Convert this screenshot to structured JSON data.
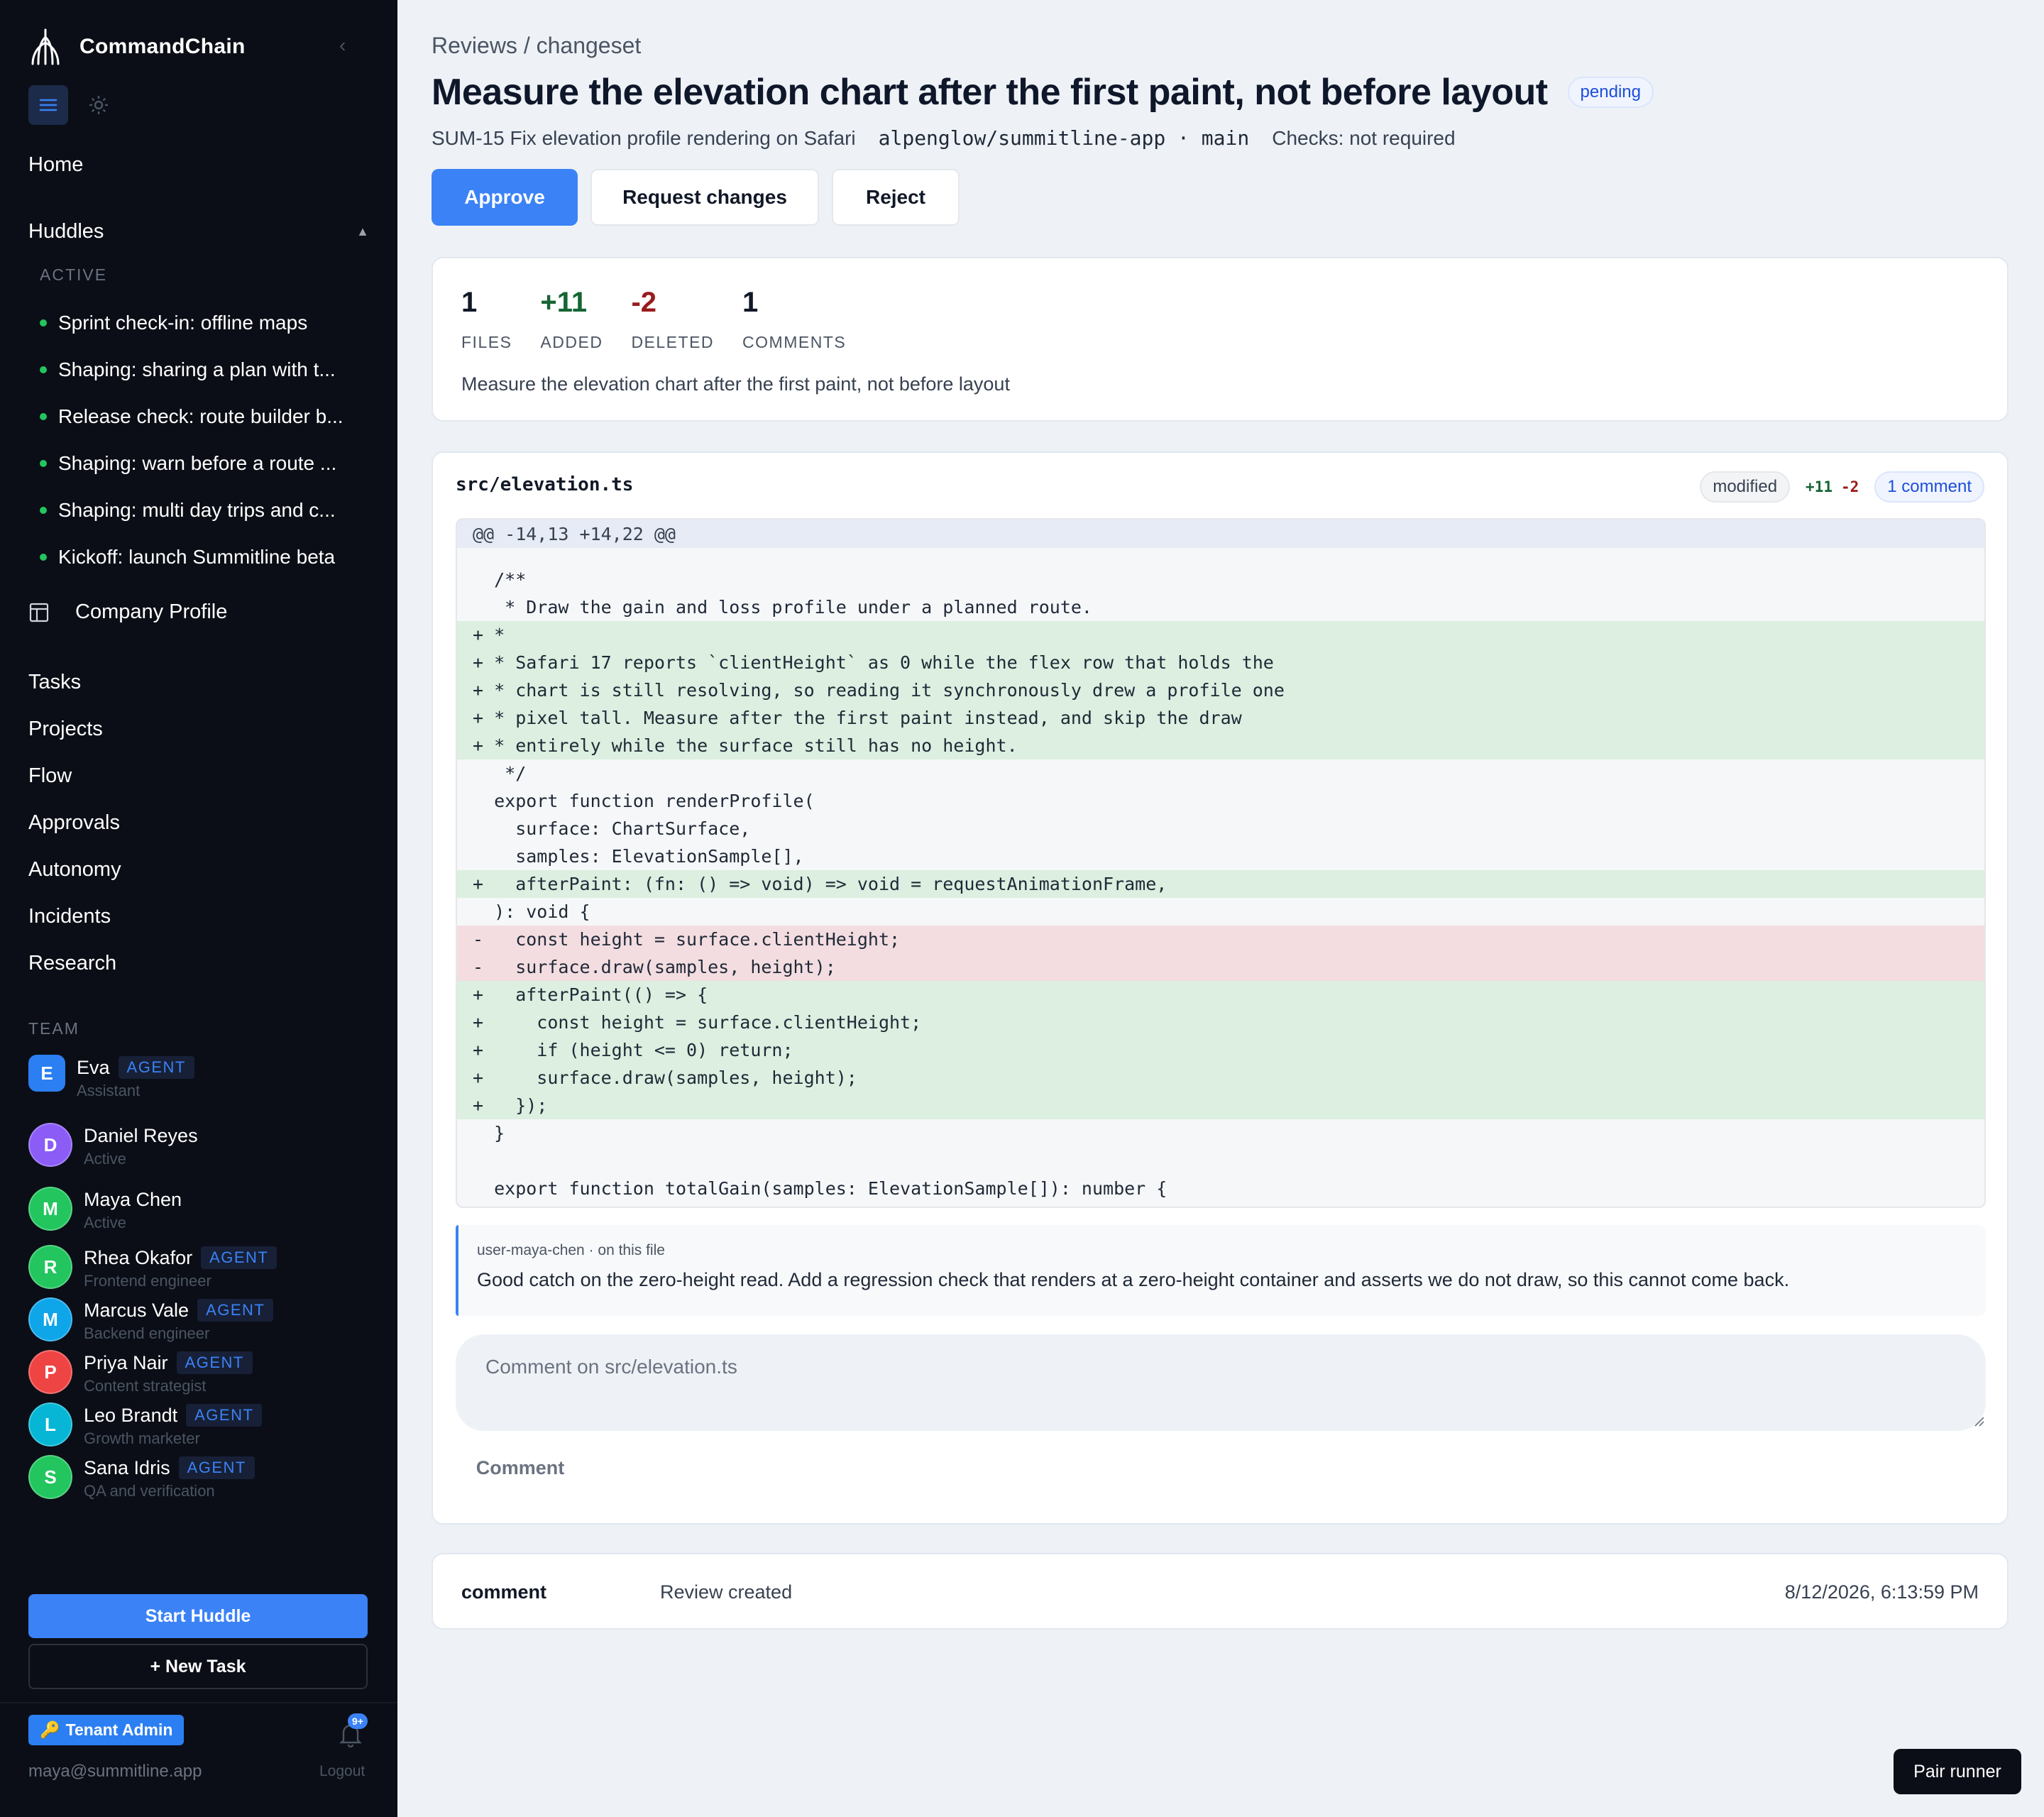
{
  "sidebar": {
    "brand": "CommandChain",
    "home": "Home",
    "huddles_label": "Huddles",
    "active_label": "ACTIVE",
    "huddles": [
      {
        "label": "Sprint check-in: offline maps"
      },
      {
        "label": "Shaping: sharing a plan with t..."
      },
      {
        "label": "Release check: route builder b..."
      },
      {
        "label": "Shaping: warn before a route ..."
      },
      {
        "label": "Shaping: multi day trips and c..."
      },
      {
        "label": "Kickoff: launch Summitline beta"
      }
    ],
    "company_profile": "Company Profile",
    "nav": [
      {
        "label": "Tasks"
      },
      {
        "label": "Projects"
      },
      {
        "label": "Flow"
      },
      {
        "label": "Approvals"
      },
      {
        "label": "Autonomy"
      },
      {
        "label": "Incidents"
      },
      {
        "label": "Research"
      }
    ],
    "team_label": "TEAM",
    "team": [
      {
        "initial": "E",
        "name": "Eva",
        "tag": "AGENT",
        "role": "Assistant",
        "color": "#2b7ff2"
      },
      {
        "initial": "D",
        "name": "Daniel Reyes",
        "tag": "",
        "role": "Active",
        "color": "#8b5cf6"
      },
      {
        "initial": "M",
        "name": "Maya Chen",
        "tag": "",
        "role": "Active",
        "color": "#22c55e"
      },
      {
        "initial": "R",
        "name": "Rhea Okafor",
        "tag": "AGENT",
        "role": "Frontend engineer",
        "color": "#22c55e"
      },
      {
        "initial": "M",
        "name": "Marcus Vale",
        "tag": "AGENT",
        "role": "Backend engineer",
        "color": "#0ea5e9"
      },
      {
        "initial": "P",
        "name": "Priya Nair",
        "tag": "AGENT",
        "role": "Content strategist",
        "color": "#ef4444"
      },
      {
        "initial": "L",
        "name": "Leo Brandt",
        "tag": "AGENT",
        "role": "Growth marketer",
        "color": "#06b6d4"
      },
      {
        "initial": "S",
        "name": "Sana Idris",
        "tag": "AGENT",
        "role": "QA and verification",
        "color": "#22c55e"
      }
    ],
    "start_huddle": "Start Huddle",
    "new_task": "+ New Task",
    "tenant_admin": "Tenant Admin",
    "notification_badge": "9+",
    "user_email": "maya@summitline.app",
    "logout": "Logout"
  },
  "review": {
    "breadcrumb": "Reviews / changeset",
    "title": "Measure the elevation chart after the first paint, not before layout",
    "status": "pending",
    "ticket": "SUM-15 Fix elevation profile rendering on Safari",
    "repo": "alpenglow/summitline-app · main",
    "checks": "Checks: not required",
    "approve": "Approve",
    "request_changes": "Request changes",
    "reject": "Reject"
  },
  "stats": {
    "files": "1",
    "files_label": "FILES",
    "added": "+11",
    "added_label": "ADDED",
    "deleted": "-2",
    "deleted_label": "DELETED",
    "comments": "1",
    "comments_label": "COMMENTS",
    "summary": "Measure the elevation chart after the first paint, not before layout"
  },
  "file": {
    "path": "src/elevation.ts",
    "status": "modified",
    "added": "+11",
    "deleted": "-2",
    "comment_count": "1 comment",
    "hunk_header": "@@ -14,13 +14,22 @@",
    "lines": [
      {
        "type": "blank",
        "text": ""
      },
      {
        "type": "ctx",
        "text": "  /**"
      },
      {
        "type": "ctx",
        "text": "   * Draw the gain and loss profile under a planned route."
      },
      {
        "type": "add",
        "text": "+ *"
      },
      {
        "type": "add",
        "text": "+ * Safari 17 reports `clientHeight` as 0 while the flex row that holds the"
      },
      {
        "type": "add",
        "text": "+ * chart is still resolving, so reading it synchronously drew a profile one"
      },
      {
        "type": "add",
        "text": "+ * pixel tall. Measure after the first paint instead, and skip the draw"
      },
      {
        "type": "add",
        "text": "+ * entirely while the surface still has no height."
      },
      {
        "type": "ctx",
        "text": "   */"
      },
      {
        "type": "ctx",
        "text": "  export function renderProfile("
      },
      {
        "type": "ctx",
        "text": "    surface: ChartSurface,"
      },
      {
        "type": "ctx",
        "text": "    samples: ElevationSample[],"
      },
      {
        "type": "add",
        "text": "+   afterPaint: (fn: () => void) => void = requestAnimationFrame,"
      },
      {
        "type": "ctx",
        "text": "  ): void {"
      },
      {
        "type": "del",
        "text": "-   const height = surface.clientHeight;"
      },
      {
        "type": "del",
        "text": "-   surface.draw(samples, height);"
      },
      {
        "type": "add",
        "text": "+   afterPaint(() => {"
      },
      {
        "type": "add",
        "text": "+     const height = surface.clientHeight;"
      },
      {
        "type": "add",
        "text": "+     if (height <= 0) return;"
      },
      {
        "type": "add",
        "text": "+     surface.draw(samples, height);"
      },
      {
        "type": "add",
        "text": "+   });"
      },
      {
        "type": "ctx",
        "text": "  }"
      },
      {
        "type": "ctx",
        "text": ""
      },
      {
        "type": "ctx",
        "text": "  export function totalGain(samples: ElevationSample[]): number {"
      }
    ],
    "comment": {
      "author": "user-maya-chen · on this file",
      "body": "Good catch on the zero-height read. Add a regression check that renders at a zero-height container and asserts we do not draw, so this cannot come back."
    },
    "comment_placeholder": "Comment on src/elevation.ts",
    "comment_button": "Comment"
  },
  "event": {
    "kind": "comment",
    "text": "Review created",
    "time": "8/12/2026, 6:13:59 PM"
  },
  "pair_runner": "Pair runner",
  "colors": {
    "accent": "#3b82f6",
    "sidebar_bg": "#0b0e16",
    "added": "#166534",
    "deleted": "#991b1b",
    "huddle_dot": "#22c55e"
  }
}
